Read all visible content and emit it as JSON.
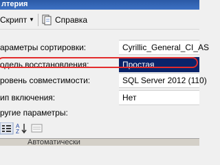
{
  "window": {
    "title": "лтерия"
  },
  "toolbar": {
    "script_label": "Скрипт",
    "help_label": "Справка"
  },
  "properties": [
    {
      "label": "араметры сортировки:",
      "value": "Cyrillic_General_CI_AS"
    },
    {
      "label": "одель восстановления:",
      "value": "Простая"
    },
    {
      "label": "ровень совместимости:",
      "value": "SQL Server 2012 (110)"
    },
    {
      "label": "ип включения:",
      "value": "Нет"
    }
  ],
  "section": {
    "other_params_label": "ругие параметры:"
  },
  "bottom": {
    "label": "Автоматически"
  },
  "colors": {
    "selected_row": "#0a246a",
    "highlight_ring": "#e32b2b",
    "titlebar": "#2b5aa6"
  }
}
